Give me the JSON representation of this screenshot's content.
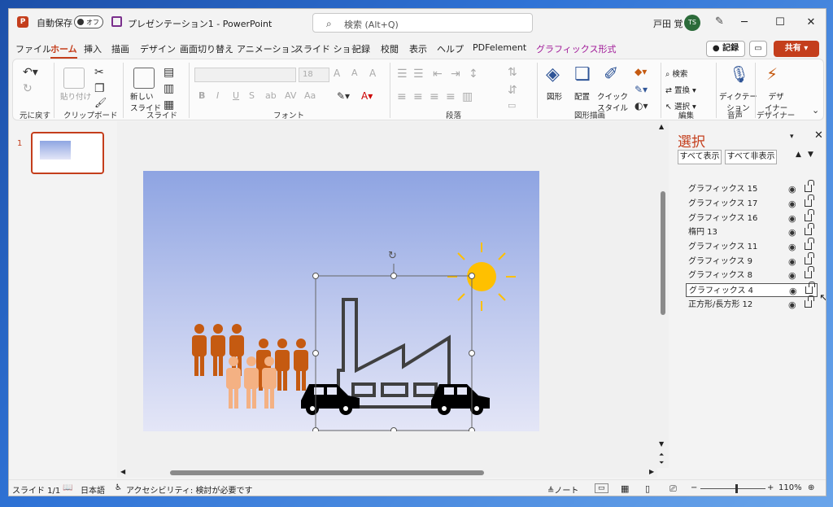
{
  "window": {
    "autosave_label": "自動保存",
    "autosave_state": "オフ",
    "doc_title": "プレゼンテーション1 - PowerPoint",
    "search_placeholder": "検索 (Alt+Q)",
    "user_name": "戸田 覚",
    "avatar_initials": "TS"
  },
  "menu": {
    "tabs": [
      "ファイル",
      "ホーム",
      "挿入",
      "描画",
      "デザイン",
      "画面切り替え",
      "アニメーション",
      "スライド ショー",
      "記録",
      "校閲",
      "表示",
      "ヘルプ",
      "PDFelement",
      "グラフィックス形式"
    ],
    "active": "ホーム",
    "record_label": "記録",
    "share_label": "共有"
  },
  "ribbon": {
    "paste_label": "貼り付け",
    "new_slide_label": "新しい\nスライド",
    "font_size": "18",
    "groups": {
      "undo": "元に戻す",
      "clipboard": "クリップボード",
      "slides": "スライド",
      "font": "フォント",
      "paragraph": "段落",
      "drawing": "図形描画",
      "editing": "編集",
      "voice": "音声",
      "designer": "デザイナー"
    },
    "shape_label": "図形",
    "arrange_label": "配置",
    "quick_style_label": "クイック\nスタイル",
    "find_label": "検索",
    "replace_label": "置換",
    "select_label": "選択",
    "dictate_label": "ディクテー\nション",
    "designer_label": "デザ\nイナー"
  },
  "slides_panel": {
    "slide_number": "1"
  },
  "selection_pane": {
    "title": "選択",
    "show_all": "すべて表示",
    "hide_all": "すべて非表示",
    "items": [
      "グラフィックス 15",
      "グラフィックス 17",
      "グラフィックス 16",
      "楕円 13",
      "グラフィックス 11",
      "グラフィックス 9",
      "グラフィックス 8",
      "グラフィックス 4",
      "正方形/長方形 12"
    ],
    "selected": "グラフィックス 4"
  },
  "status": {
    "slide_info": "スライド 1/1",
    "language": "日本語",
    "accessibility": "アクセシビリティ: 検討が必要です",
    "notes": "ノート",
    "zoom": "110%",
    "zoom_level": 0.55
  },
  "colors": {
    "accent": "#c43e1c",
    "context_tab": "#a01898",
    "sun": "#ffc000",
    "people_dark": "#c55a11",
    "people_light": "#f4b183",
    "factory": "#404040",
    "car": "#000000"
  }
}
